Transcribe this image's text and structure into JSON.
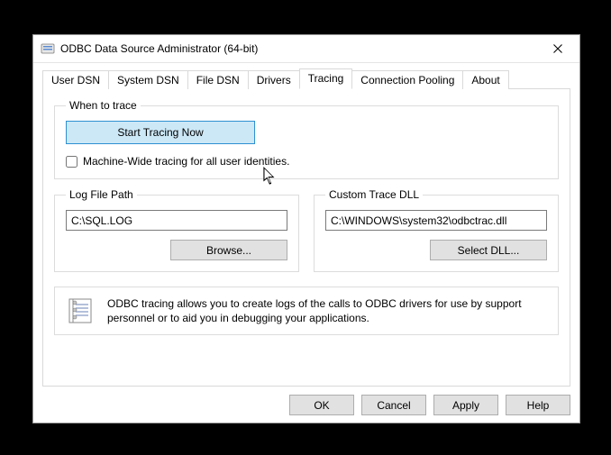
{
  "window": {
    "title": "ODBC Data Source Administrator (64-bit)"
  },
  "tabs": [
    {
      "label": "User DSN"
    },
    {
      "label": "System DSN"
    },
    {
      "label": "File DSN"
    },
    {
      "label": "Drivers"
    },
    {
      "label": "Tracing"
    },
    {
      "label": "Connection Pooling"
    },
    {
      "label": "About"
    }
  ],
  "active_tab_index": 4,
  "tracing": {
    "when_to_trace_legend": "When to trace",
    "start_button": "Start Tracing Now",
    "machine_wide_label": "Machine-Wide tracing for all user identities.",
    "machine_wide_checked": false,
    "log_file_path_legend": "Log File Path",
    "log_file_path_value": "C:\\SQL.LOG",
    "browse_button": "Browse...",
    "custom_dll_legend": "Custom Trace DLL",
    "custom_dll_value": "C:\\WINDOWS\\system32\\odbctrac.dll",
    "select_dll_button": "Select DLL...",
    "description": "ODBC tracing allows you to create logs of the calls to ODBC drivers for use by support personnel or to aid you in debugging your applications."
  },
  "dialog_buttons": {
    "ok": "OK",
    "cancel": "Cancel",
    "apply": "Apply",
    "help": "Help"
  }
}
